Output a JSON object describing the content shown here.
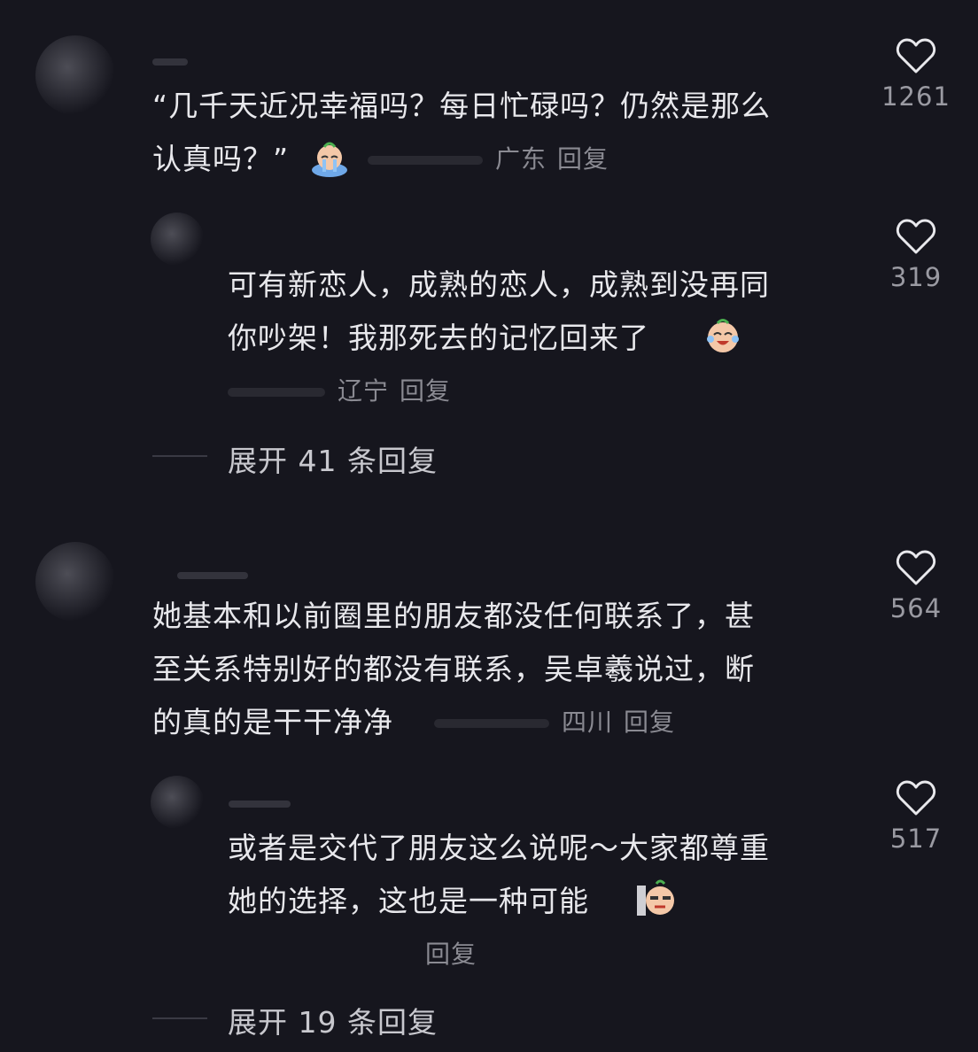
{
  "comments": [
    {
      "text": "“几千天近况幸福吗？每日忙碌吗？仍然是那么\n认真吗？”",
      "region": "广东",
      "reply_label": "回复",
      "likes": "1261",
      "icon": "crying-emoji"
    },
    {
      "text": "可有新恋人，成熟的恋人，成熟到没再同\n你吵架！我那死去的记忆回来了",
      "region": "辽宁",
      "reply_label": "回复",
      "likes": "319",
      "icon": "laugh-cry-emoji"
    },
    {
      "text": "她基本和以前圈里的朋友都没任何联系了，甚\n至关系特别好的都没有联系，吴卓羲说过，断\n的真的是干干净净",
      "region": "四川",
      "reply_label": "回复",
      "likes": "564"
    },
    {
      "text": "或者是交代了朋友这么说呢～大家都尊重\n她的选择，这也是一种可能",
      "reply_label": "回复",
      "likes": "517",
      "icon": "side-eye-emoji"
    }
  ],
  "expand_buttons": [
    {
      "label": "展开 41 条回复"
    },
    {
      "label": "展开 19 条回复"
    }
  ],
  "colors": {
    "background": "#16161e",
    "text": "#e8e8ec",
    "meta": "#8a8a92"
  }
}
